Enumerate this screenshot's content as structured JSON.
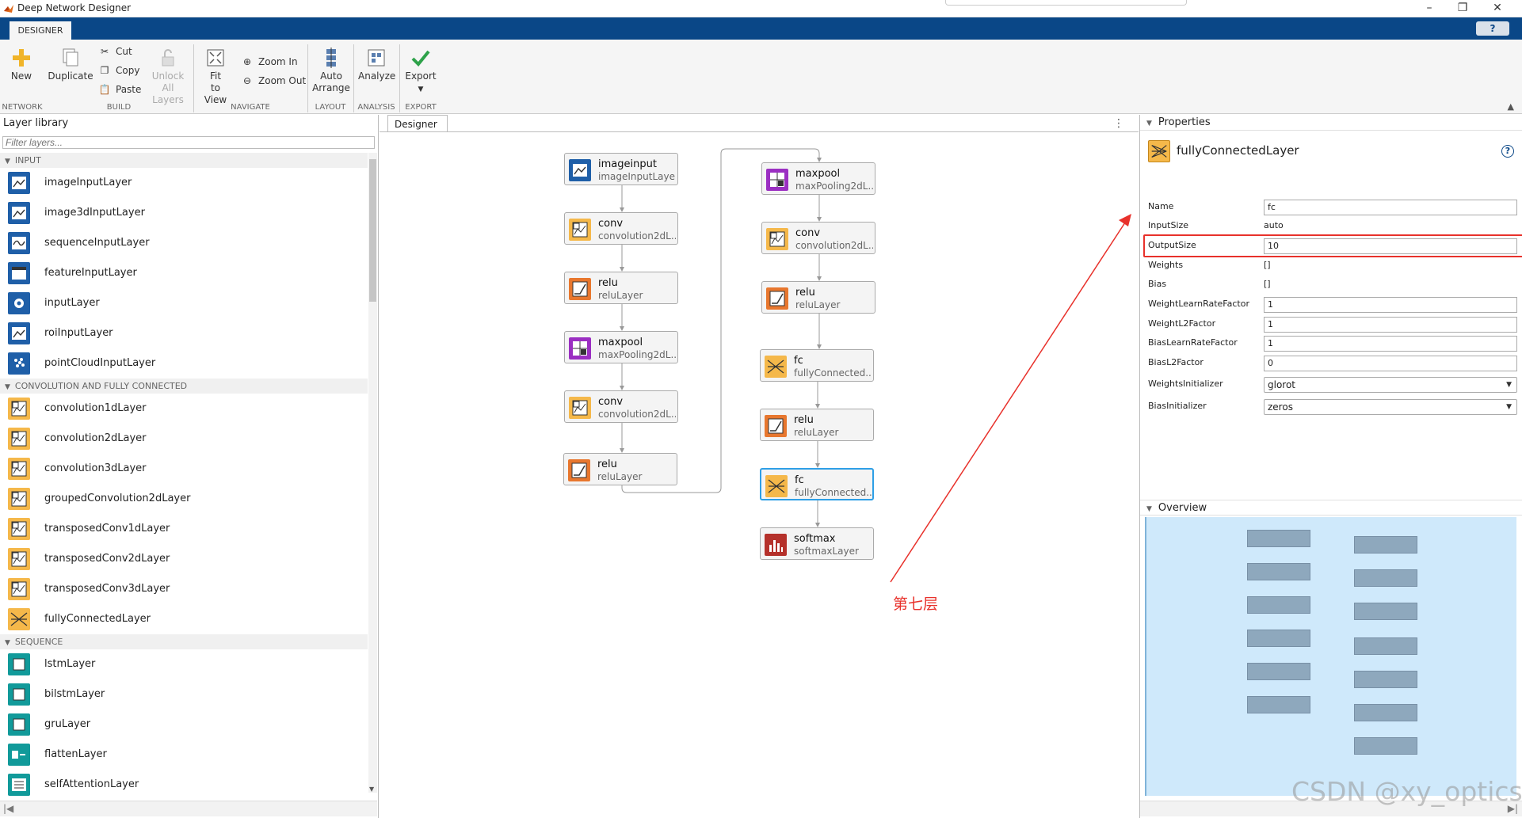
{
  "window": {
    "title": "Deep Network Designer",
    "minimize": "–",
    "restore": "❐",
    "close": "✕"
  },
  "tabs": {
    "designer": "DESIGNER",
    "help": "?"
  },
  "toolstrip": {
    "new": "New",
    "duplicate": "Duplicate",
    "cut": "Cut",
    "copy": "Copy",
    "paste": "Paste",
    "unlock_line1": "Unlock",
    "unlock_line2": "All Layers",
    "fit_line1": "Fit",
    "fit_line2": "to View",
    "zoom_in": "Zoom In",
    "zoom_out": "Zoom Out",
    "auto_line1": "Auto",
    "auto_line2": "Arrange",
    "analyze": "Analyze",
    "export": "Export",
    "groups": {
      "network": "NETWORK",
      "build": "BUILD",
      "navigate": "NAVIGATE",
      "layout": "LAYOUT",
      "analysis": "ANALYSIS",
      "export": "EXPORT"
    }
  },
  "library": {
    "title": "Layer library",
    "filter_placeholder": "Filter layers...",
    "categories": [
      {
        "name": "INPUT",
        "items": [
          "imageInputLayer",
          "image3dInputLayer",
          "sequenceInputLayer",
          "featureInputLayer",
          "inputLayer",
          "roiInputLayer",
          "pointCloudInputLayer"
        ]
      },
      {
        "name": "CONVOLUTION AND FULLY CONNECTED",
        "items": [
          "convolution1dLayer",
          "convolution2dLayer",
          "convolution3dLayer",
          "groupedConvolution2dLayer",
          "transposedConv1dLayer",
          "transposedConv2dLayer",
          "transposedConv3dLayer",
          "fullyConnectedLayer"
        ]
      },
      {
        "name": "SEQUENCE",
        "items": [
          "lstmLayer",
          "bilstmLayer",
          "gruLayer",
          "flattenLayer",
          "selfAttentionLayer"
        ]
      }
    ],
    "icon_colors": {
      "input": "#1f5fa8",
      "conv": "#f5b84a",
      "sequence": "#119a9a"
    }
  },
  "designer": {
    "tab": "Designer",
    "menu": "⋮",
    "nodes": [
      {
        "name": "imageinput",
        "type": "imageInputLayer",
        "icon": "image-input-icon"
      },
      {
        "name": "conv",
        "type": "convolution2dL...",
        "icon": "convolution-icon"
      },
      {
        "name": "relu",
        "type": "reluLayer",
        "icon": "relu-icon"
      },
      {
        "name": "maxpool",
        "type": "maxPooling2dL...",
        "icon": "maxpool-icon"
      },
      {
        "name": "conv",
        "type": "convolution2dL...",
        "icon": "convolution-icon"
      },
      {
        "name": "relu",
        "type": "reluLayer",
        "icon": "relu-icon"
      },
      {
        "name": "maxpool",
        "type": "maxPooling2dL...",
        "icon": "maxpool-icon"
      },
      {
        "name": "conv",
        "type": "convolution2dL...",
        "icon": "convolution-icon"
      },
      {
        "name": "relu",
        "type": "reluLayer",
        "icon": "relu-icon"
      },
      {
        "name": "fc",
        "type": "fullyConnected...",
        "icon": "fully-connected-icon"
      },
      {
        "name": "relu",
        "type": "reluLayer",
        "icon": "relu-icon"
      },
      {
        "name": "fc",
        "type": "fullyConnected...",
        "icon": "fully-connected-icon",
        "selected": true
      },
      {
        "name": "softmax",
        "type": "softmaxLayer",
        "icon": "softmax-icon"
      }
    ],
    "annotation": "第七层",
    "annotation_color": "#e8312b",
    "selection_color": "#2e9fe6"
  },
  "properties": {
    "title": "Properties",
    "layer_type": "fullyConnectedLayer",
    "help": "?",
    "rows": [
      {
        "key": "Name",
        "value": "fc",
        "kind": "input"
      },
      {
        "key": "InputSize",
        "value": "auto",
        "kind": "text"
      },
      {
        "key": "OutputSize",
        "value": "10",
        "kind": "input",
        "highlighted": true
      },
      {
        "key": "Weights",
        "value": "[]",
        "kind": "text"
      },
      {
        "key": "Bias",
        "value": "[]",
        "kind": "text"
      },
      {
        "key": "WeightLearnRateFactor",
        "value": "1",
        "kind": "input"
      },
      {
        "key": "WeightL2Factor",
        "value": "1",
        "kind": "input"
      },
      {
        "key": "BiasLearnRateFactor",
        "value": "1",
        "kind": "input"
      },
      {
        "key": "BiasL2Factor",
        "value": "0",
        "kind": "input"
      },
      {
        "key": "WeightsInitializer",
        "value": "glorot",
        "kind": "select"
      },
      {
        "key": "BiasInitializer",
        "value": "zeros",
        "kind": "select"
      }
    ]
  },
  "overview": {
    "title": "Overview"
  },
  "watermark": "CSDN @xy_optics"
}
